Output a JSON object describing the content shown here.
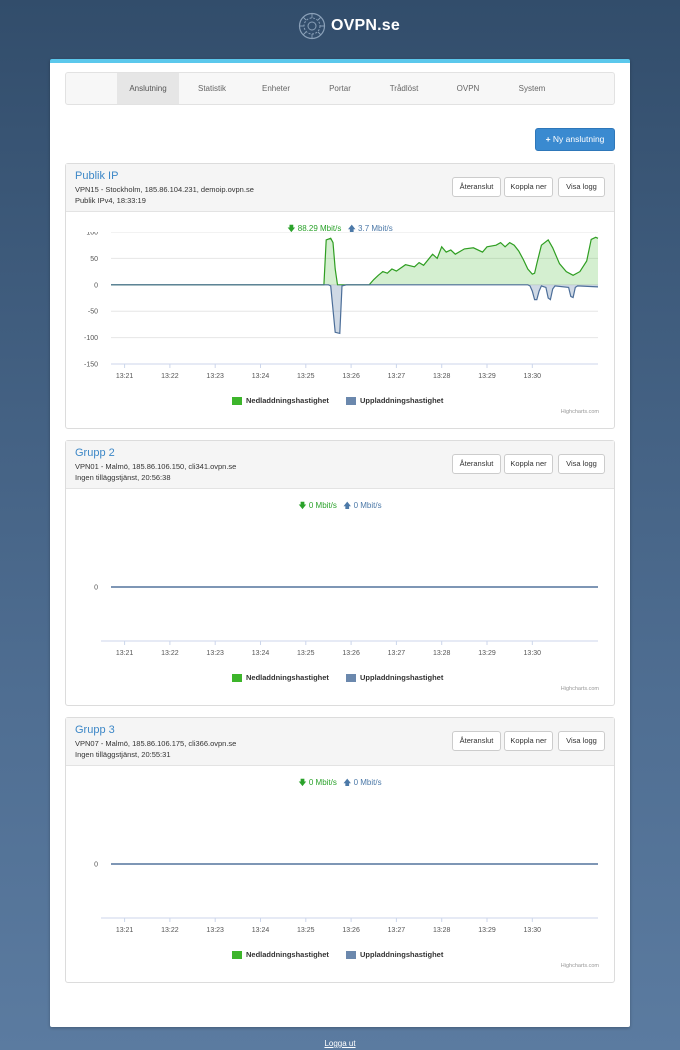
{
  "brand": {
    "name": "OVPN.se"
  },
  "nav": {
    "items": [
      "Anslutning",
      "Statistik",
      "Enheter",
      "Portar",
      "Trådlöst",
      "OVPN",
      "System"
    ],
    "active": 0
  },
  "new_connection_button": "Ny anslutning",
  "buttons": {
    "reconnect": "Återanslut",
    "disconnect": "Koppla ner",
    "show_log": "Visa logg"
  },
  "legend": {
    "download": "Nedladdningshastighet",
    "upload": "Uppladdningshastighet",
    "download_color": "#3db52b",
    "upload_color": "#6b88ad"
  },
  "credits": "Highcharts.com",
  "logout": "Logga ut",
  "connections": [
    {
      "title": "Publik IP",
      "line1": "VPN15 - Stockholm, 185.86.104.231, demoip.ovpn.se",
      "line2": "Publik IPv4, 18:33:19",
      "download_rate": "88.29 Mbit/s",
      "upload_rate": "3.7 Mbit/s"
    },
    {
      "title": "Grupp 2",
      "line1": "VPN01 - Malmö, 185.86.106.150, cli341.ovpn.se",
      "line2": "Ingen tilläggstjänst, 20:56:38",
      "download_rate": "0 Mbit/s",
      "upload_rate": "0 Mbit/s"
    },
    {
      "title": "Grupp 3",
      "line1": "VPN07 - Malmö, 185.86.106.175, cli366.ovpn.se",
      "line2": "Ingen tilläggstjänst, 20:55:31",
      "download_rate": "0 Mbit/s",
      "upload_rate": "0 Mbit/s"
    }
  ],
  "chart_data": [
    {
      "type": "area",
      "x_categories": [
        "13:21",
        "13:22",
        "13:23",
        "13:24",
        "13:25",
        "13:26",
        "13:27",
        "13:28",
        "13:29",
        "13:30"
      ],
      "y_ticks": [
        100,
        50,
        0,
        -50,
        -100,
        -150
      ],
      "ylim": [
        -150,
        100
      ],
      "xlim": [
        13.2,
        23.95
      ],
      "series": [
        {
          "name": "Nedladdningshastighet",
          "points": [
            [
              13.2,
              0
            ],
            [
              17.9,
              0
            ],
            [
              17.95,
              85
            ],
            [
              18.05,
              88
            ],
            [
              18.1,
              80
            ],
            [
              18.15,
              30
            ],
            [
              18.2,
              0
            ],
            [
              18.9,
              0
            ],
            [
              19.0,
              10
            ],
            [
              19.1,
              18
            ],
            [
              19.2,
              25
            ],
            [
              19.3,
              22
            ],
            [
              19.4,
              30
            ],
            [
              19.5,
              26
            ],
            [
              19.7,
              38
            ],
            [
              19.9,
              34
            ],
            [
              20.0,
              42
            ],
            [
              20.1,
              37
            ],
            [
              20.3,
              58
            ],
            [
              20.4,
              50
            ],
            [
              20.5,
              72
            ],
            [
              20.6,
              62
            ],
            [
              20.7,
              66
            ],
            [
              20.8,
              58
            ],
            [
              21.0,
              68
            ],
            [
              21.2,
              70
            ],
            [
              21.4,
              62
            ],
            [
              21.5,
              72
            ],
            [
              21.7,
              75
            ],
            [
              21.8,
              80
            ],
            [
              21.9,
              72
            ],
            [
              22.0,
              80
            ],
            [
              22.1,
              75
            ],
            [
              22.2,
              64
            ],
            [
              22.3,
              48
            ],
            [
              22.4,
              30
            ],
            [
              22.5,
              20
            ],
            [
              22.55,
              22
            ],
            [
              22.6,
              40
            ],
            [
              22.7,
              75
            ],
            [
              22.85,
              85
            ],
            [
              22.95,
              70
            ],
            [
              23.1,
              40
            ],
            [
              23.25,
              25
            ],
            [
              23.4,
              18
            ],
            [
              23.55,
              25
            ],
            [
              23.7,
              45
            ],
            [
              23.8,
              86
            ],
            [
              23.9,
              90
            ],
            [
              23.95,
              88
            ]
          ]
        },
        {
          "name": "Uppladdningshastighet",
          "points": [
            [
              13.2,
              0
            ],
            [
              18.0,
              0
            ],
            [
              18.05,
              -2
            ],
            [
              18.15,
              -90
            ],
            [
              18.25,
              -92
            ],
            [
              18.3,
              -2
            ],
            [
              18.4,
              0
            ],
            [
              22.4,
              0
            ],
            [
              22.45,
              -2
            ],
            [
              22.5,
              -12
            ],
            [
              22.55,
              -28
            ],
            [
              22.6,
              -28
            ],
            [
              22.65,
              -12
            ],
            [
              22.7,
              -2
            ],
            [
              22.8,
              -5
            ],
            [
              22.85,
              -25
            ],
            [
              22.9,
              -28
            ],
            [
              22.95,
              -8
            ],
            [
              23.0,
              -2
            ],
            [
              23.3,
              -5
            ],
            [
              23.35,
              -22
            ],
            [
              23.4,
              -24
            ],
            [
              23.45,
              -5
            ],
            [
              23.5,
              -2
            ],
            [
              23.95,
              -4
            ]
          ]
        }
      ]
    },
    {
      "type": "area",
      "x_categories": [
        "13:21",
        "13:22",
        "13:23",
        "13:24",
        "13:25",
        "13:26",
        "13:27",
        "13:28",
        "13:29",
        "13:30"
      ],
      "y_ticks": [
        0
      ],
      "xlim": [
        13.2,
        23.95
      ],
      "series": [
        {
          "name": "Nedladdningshastighet",
          "points": [
            [
              13.2,
              0
            ],
            [
              23.95,
              0
            ]
          ]
        },
        {
          "name": "Uppladdningshastighet",
          "points": [
            [
              13.2,
              0
            ],
            [
              23.95,
              0
            ]
          ]
        }
      ]
    },
    {
      "type": "area",
      "x_categories": [
        "13:21",
        "13:22",
        "13:23",
        "13:24",
        "13:25",
        "13:26",
        "13:27",
        "13:28",
        "13:29",
        "13:30"
      ],
      "y_ticks": [
        0
      ],
      "xlim": [
        13.2,
        23.95
      ],
      "series": [
        {
          "name": "Nedladdningshastighet",
          "points": [
            [
              13.2,
              0
            ],
            [
              23.95,
              0
            ]
          ]
        },
        {
          "name": "Uppladdningshastighet",
          "points": [
            [
              13.2,
              0
            ],
            [
              23.95,
              0
            ]
          ]
        }
      ]
    }
  ]
}
